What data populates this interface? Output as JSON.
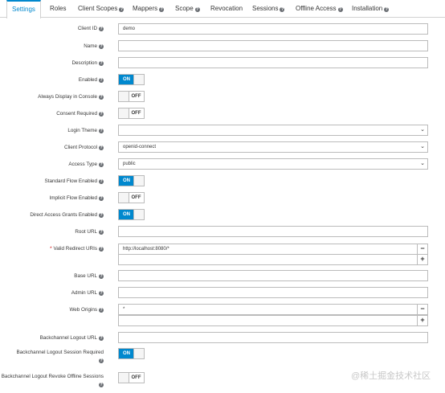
{
  "tabs": [
    {
      "label": "Settings",
      "help": false
    },
    {
      "label": "Roles",
      "help": false
    },
    {
      "label": "Client Scopes",
      "help": true
    },
    {
      "label": "Mappers",
      "help": true
    },
    {
      "label": "Scope",
      "help": true
    },
    {
      "label": "Revocation",
      "help": false
    },
    {
      "label": "Sessions",
      "help": true
    },
    {
      "label": "Offline Access",
      "help": true
    },
    {
      "label": "Installation",
      "help": true
    }
  ],
  "form": {
    "client_id": {
      "label": "Client ID",
      "value": "demo"
    },
    "name": {
      "label": "Name",
      "value": ""
    },
    "description": {
      "label": "Description",
      "value": ""
    },
    "enabled": {
      "label": "Enabled",
      "state": "ON"
    },
    "always_display": {
      "label": "Always Display in Console",
      "state": "OFF"
    },
    "consent_required": {
      "label": "Consent Required",
      "state": "OFF"
    },
    "login_theme": {
      "label": "Login Theme",
      "value": ""
    },
    "client_protocol": {
      "label": "Client Protocol",
      "value": "openid-connect"
    },
    "access_type": {
      "label": "Access Type",
      "value": "public"
    },
    "standard_flow": {
      "label": "Standard Flow Enabled",
      "state": "ON"
    },
    "implicit_flow": {
      "label": "Implicit Flow Enabled",
      "state": "OFF"
    },
    "direct_access": {
      "label": "Direct Access Grants Enabled",
      "state": "ON"
    },
    "root_url": {
      "label": "Root URL",
      "value": ""
    },
    "redirect_uris": {
      "label": "Valid Redirect URIs",
      "required_mark": "*",
      "values": [
        "http://localhost:8080/*",
        ""
      ]
    },
    "base_url": {
      "label": "Base URL",
      "value": ""
    },
    "admin_url": {
      "label": "Admin URL",
      "value": ""
    },
    "web_origins": {
      "label": "Web Origins",
      "values": [
        "*",
        ""
      ]
    },
    "backchannel_logout_url": {
      "label": "Backchannel Logout URL",
      "value": ""
    },
    "backchannel_session_required": {
      "label": "Backchannel Logout Session Required",
      "state": "ON"
    },
    "backchannel_revoke_offline": {
      "label": "Backchannel Logout Revoke Offline Sessions",
      "state": "OFF"
    }
  },
  "buttons": {
    "minus": "−",
    "plus": "+"
  },
  "icons": {
    "help": "?",
    "caret": "⌄"
  },
  "colors": {
    "accent": "#0088ce",
    "required": "#cc0000"
  },
  "watermark": "@稀土掘金技术社区"
}
